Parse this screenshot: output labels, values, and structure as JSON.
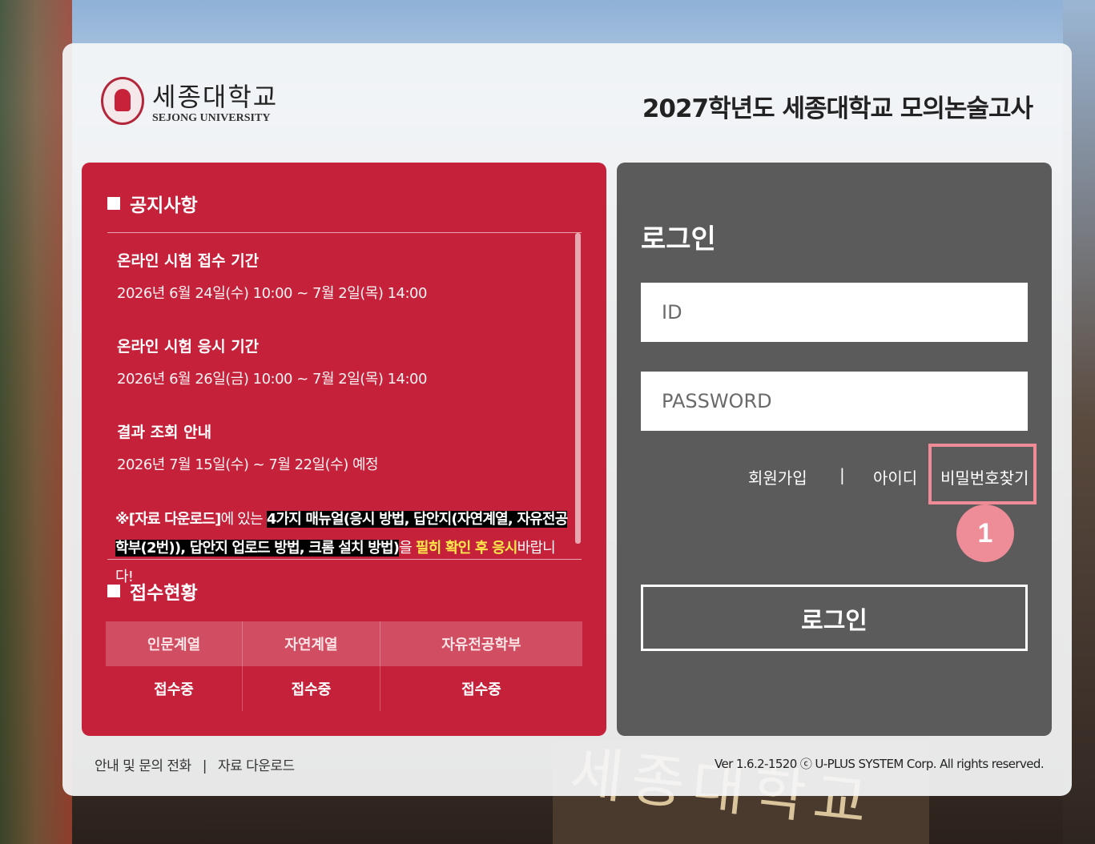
{
  "header": {
    "logo_korean": "세종대학교",
    "logo_english": "SEJONG UNIVERSITY",
    "page_title": "2027학년도 세종대학교 모의논술고사"
  },
  "notice": {
    "heading": "공지사항",
    "items": [
      {
        "title": "온라인 시험 접수 기간",
        "date": "2026년 6월 24일(수) 10:00 ~ 7월 2일(목) 14:00"
      },
      {
        "title": "온라인 시험 응시 기간",
        "date": "2026년 6월 26일(금) 10:00 ~ 7월 2일(목) 14:00"
      },
      {
        "title": "결과 조회 안내",
        "date": "2026년 7월 15일(수) ~ 7월 22일(수) 예정"
      }
    ],
    "note": {
      "p1": "※[자료 다운로드]",
      "p2": "에 있는 ",
      "p3": "4가지 매뉴얼(응시 방법, 답안지(자연계열, 자유전공학부(2번)), 답안지 업로드 방법, 크롬 설치 방법)",
      "p4": "을 ",
      "p5": "필히 확인 후 응시",
      "p6": "바랍니다!"
    }
  },
  "status": {
    "heading": "접수현황",
    "columns": [
      "인문계열",
      "자연계열",
      "자유전공학부"
    ],
    "values": [
      "접수중",
      "접수중",
      "접수중"
    ]
  },
  "login": {
    "title": "로그인",
    "id_placeholder": "ID",
    "pw_placeholder": "PASSWORD",
    "link_join": "회원가입",
    "link_sep": "|",
    "link_find_id": "아이디",
    "link_find_pw": "비밀번호찾기",
    "button": "로그인"
  },
  "annotation": {
    "step": "1"
  },
  "footer": {
    "contact": "안내 및 문의 전화",
    "sep": "|",
    "download": "자료 다운로드",
    "version": "Ver 1.6.2-1520 ⓒ U-PLUS SYSTEM Corp. All rights reserved."
  },
  "background": {
    "sign_text": "세종대학교"
  }
}
